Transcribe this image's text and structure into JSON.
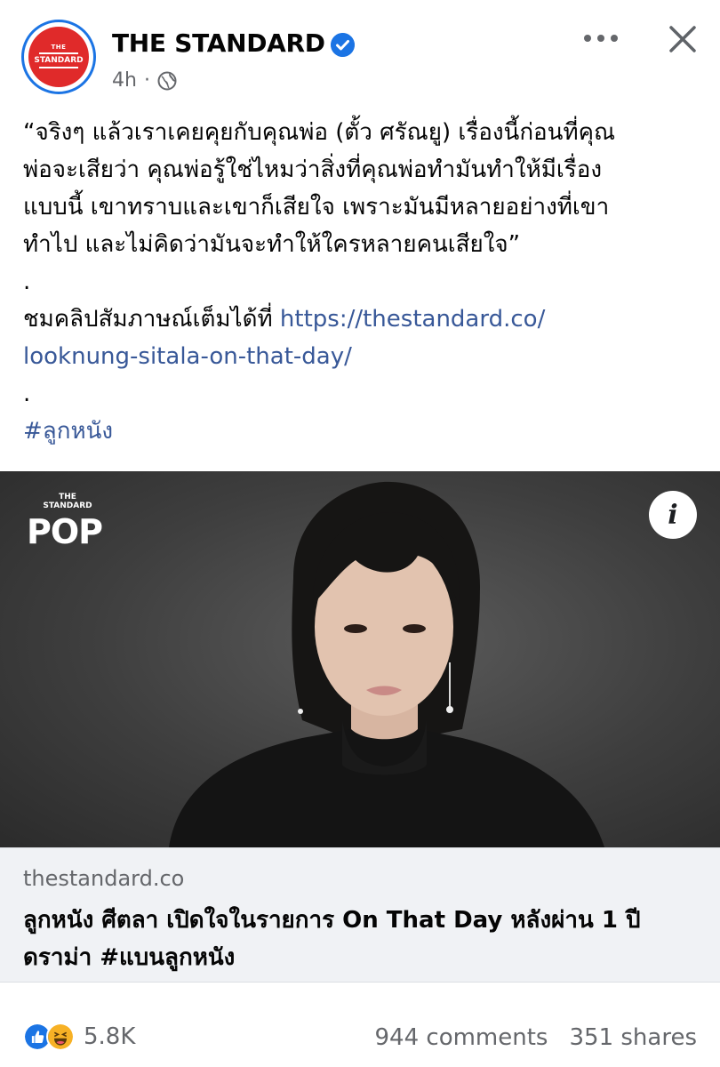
{
  "post": {
    "page_name": "THE STANDARD",
    "time": "4h",
    "separator": "·",
    "avatar": {
      "top": "THE",
      "bottom": "STANDARD"
    },
    "text_lines": [
      "“จริงๆ แล้วเราเคยคุยกับคุณพ่อ (ตั้ว ศรัณยู) เรื่องนี้ก่อนที่คุณ",
      "พ่อจะเสียว่า คุณพ่อรู้ใช่ไหมว่าสิ่งที่คุณพ่อทำมันทำให้มีเรื่อง",
      "แบบนี้ เขาทราบและเขาก็เสียใจ เพราะมันมีหลายอย่างที่เขา",
      "ทำไป และไม่คิดว่ามันจะทำให้ใครหลายคนเสียใจ”",
      "."
    ],
    "clip_prefix": "ชมคลิปสัมภาษณ์เต็มได้ที่ ",
    "link_line1": "https://thestandard.co/",
    "link_line2": "looknung-sitala-on-that-day/",
    "dot2": ".",
    "hashtag": "#ลูกหนัง"
  },
  "media": {
    "brand_small_top": "THE",
    "brand_small_bottom": "STANDARD",
    "brand_pop": "POP",
    "info_label": "i"
  },
  "link_card": {
    "domain": "thestandard.co",
    "headline": "ลูกหนัง ศีตลา เปิดใจในรายการ On That Day หลังผ่าน 1 ปี ดราม่า #แบนลูกหนัง"
  },
  "footer": {
    "reaction_count": "5.8K",
    "comments": "944 comments",
    "shares": "351 shares"
  },
  "colors": {
    "accent": "#1b74e4",
    "link": "#385898",
    "brand_red": "#e02a2a",
    "muted": "#65676b"
  },
  "icons": [
    "verified-icon",
    "globe-icon",
    "more-icon",
    "close-icon",
    "info-icon",
    "like-icon",
    "haha-icon"
  ]
}
